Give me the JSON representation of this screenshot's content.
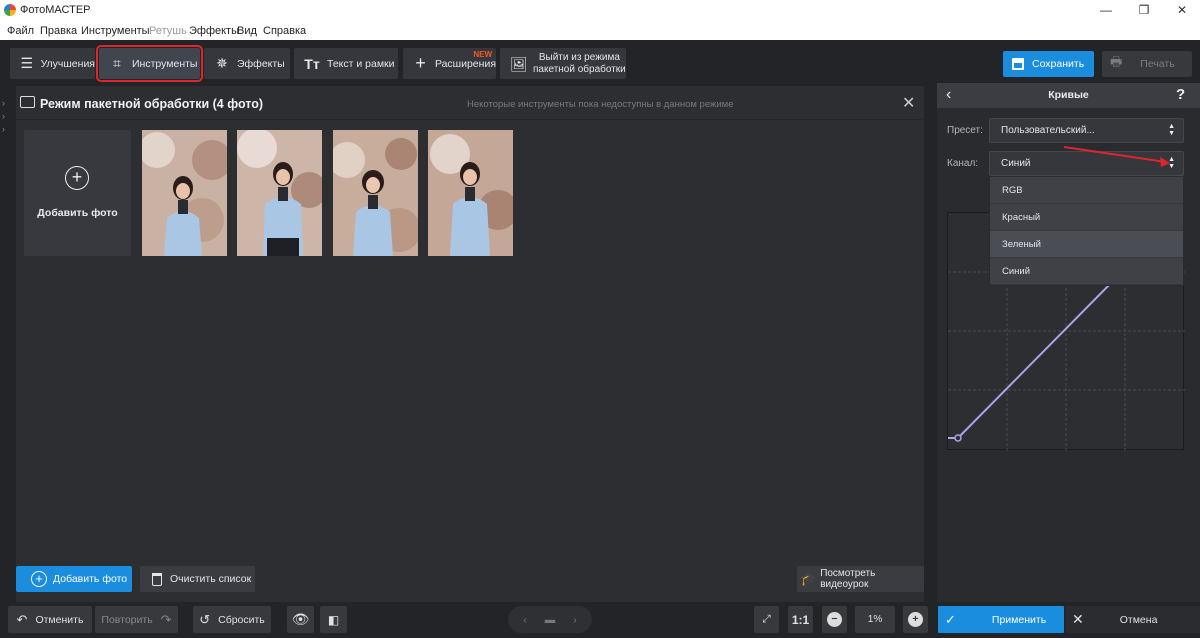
{
  "window": {
    "title": "ФотоМАСТЕР",
    "min": "—",
    "max": "❐",
    "close": "✕"
  },
  "menu": [
    "Файл",
    "Правка",
    "Инструменты",
    "Ретушь",
    "Эффекты",
    "Вид",
    "Справка"
  ],
  "toolbar": {
    "tabs": [
      {
        "label": "Улучшения",
        "icon": "sliders-icon"
      },
      {
        "label": "Инструменты",
        "icon": "crop-icon",
        "active": true
      },
      {
        "label": "Эффекты",
        "icon": "magic-wand-icon"
      },
      {
        "label": "Текст и рамки",
        "icon": "text-icon"
      },
      {
        "label": "Расширения",
        "icon": "plus-icon",
        "badge": "NEW"
      }
    ],
    "exit_batch": {
      "line1": "Выйти из режима",
      "line2": "пакетной обработки"
    },
    "save": "Сохранить",
    "print": "Печать"
  },
  "panel": {
    "title": "Режим пакетной обработки (4 фото)",
    "note": "Некоторые инструменты пока недоступны в данном режиме",
    "add_photo_tile": "Добавить фото",
    "photo_count": 4
  },
  "list_actions": {
    "add_photo": "Добавить фото",
    "clear_list": "Очистить список",
    "video": "Посмотреть видеоурок"
  },
  "bottom": {
    "undo": "Отменить",
    "redo": "Повторить",
    "reset": "Сбросить",
    "one_to_one": "1:1",
    "zoom": "1%"
  },
  "curves": {
    "title": "Кривые",
    "help": "?",
    "preset_label": "Пресет:",
    "preset_value": "Пользовательский...",
    "channel_label": "Канал:",
    "channel_value": "Синий",
    "channel_options": [
      "RGB",
      "Красный",
      "Зеленый",
      "Синий"
    ],
    "highlighted_option": "Зеленый",
    "apply": "Применить",
    "cancel": "Отмена"
  },
  "colors": {
    "accent": "#1a8dde",
    "highlight_outline": "#e0252c",
    "curve": "#a9a4e8",
    "new_badge": "#f0591e"
  }
}
